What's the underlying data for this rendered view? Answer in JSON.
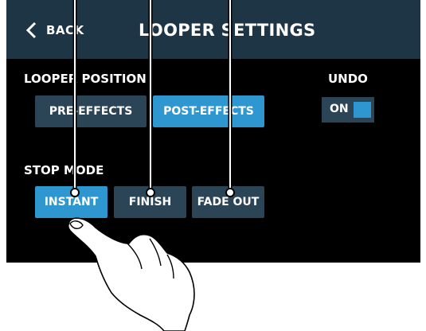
{
  "header": {
    "back_label": "BACK",
    "title": "LOOPER SETTINGS"
  },
  "looper_position": {
    "label": "LOOPER POSITION",
    "options": [
      "PRE-EFFECTS",
      "POST-EFFECTS"
    ],
    "selected": "POST-EFFECTS"
  },
  "undo": {
    "label": "UNDO",
    "toggle_label": "ON",
    "state": "on"
  },
  "stop_mode": {
    "label": "STOP MODE",
    "options": [
      "INSTANT",
      "FINISH",
      "FADE OUT"
    ],
    "selected": "INSTANT"
  },
  "colors": {
    "header_bg": "#1d3545",
    "screen_bg": "#000000",
    "button_off": "#2b4557",
    "button_on": "#2f97d0",
    "text": "#ffffff"
  },
  "icons": {
    "back": "chevron-left-icon",
    "hand": "finger-tap-hand-icon"
  }
}
